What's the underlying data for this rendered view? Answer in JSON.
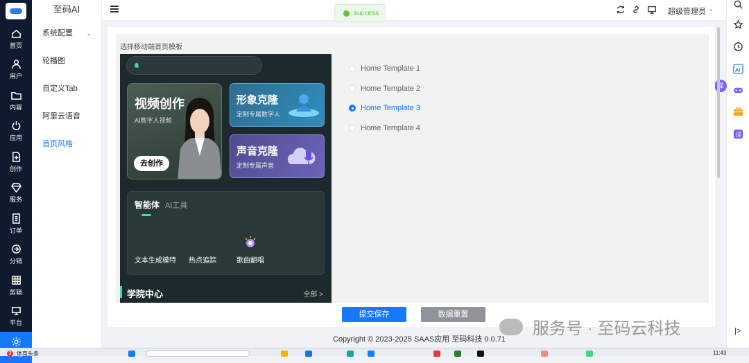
{
  "rail": {
    "items": [
      {
        "label": "首页",
        "icon": "home-icon"
      },
      {
        "label": "用户",
        "icon": "user-icon"
      },
      {
        "label": "内容",
        "icon": "folder-icon"
      },
      {
        "label": "应用",
        "icon": "power-icon"
      },
      {
        "label": "创作",
        "icon": "plus-doc-icon"
      },
      {
        "label": "服务",
        "icon": "diamond-icon"
      },
      {
        "label": "订单",
        "icon": "receipt-icon"
      },
      {
        "label": "分销",
        "icon": "share-icon"
      },
      {
        "label": "剪辑",
        "icon": "grid-icon"
      },
      {
        "label": "平台",
        "icon": "monitor-icon"
      },
      {
        "label": "系统",
        "icon": "gear-icon"
      }
    ],
    "active_index": 10,
    "active_color": "#1677ff"
  },
  "submenu": {
    "title": "至码AI",
    "items": [
      "系统配置",
      "轮播图",
      "自定义Tab",
      "阿里云语音",
      "首页风格"
    ],
    "active": "首页风格"
  },
  "topbar": {
    "toast": "success",
    "user": "超级管理员"
  },
  "main": {
    "section_label": "选择移动端首页模板",
    "preview": {
      "hero_title": "视频创作",
      "hero_sub": "AI数字人视频",
      "hero_btn": "去创作",
      "card1_title": "形象克隆",
      "card1_sub": "定制专属数字人",
      "card2_title": "声音克隆",
      "card2_sub": "定制专属声音",
      "tab_active": "智能体",
      "tab_other": "AI工具",
      "agent_items": [
        "文本生成模特",
        "热点追踪",
        "歌曲翻唱"
      ],
      "academy": "学院中心",
      "all": "全部"
    },
    "templates": [
      "Home Template 1",
      "Home Template 2",
      "Home Template 3",
      "Home Template 4"
    ],
    "selected_template": "Home Template 3",
    "save_button": "提交保存",
    "reset_button": "数据重置"
  },
  "footer": {
    "copyright": "Copyright © 2023-2025 SAAS应用  至码科技 0.0.71"
  },
  "watermark": "服务号 · 至码云科技",
  "float_badge": "译",
  "taskbar": {
    "news": "体育头条",
    "badge": "3",
    "time": "11:43"
  }
}
